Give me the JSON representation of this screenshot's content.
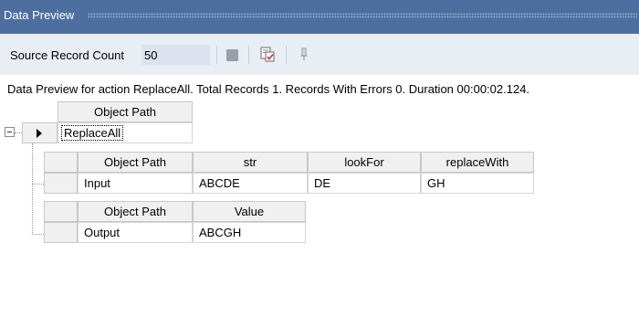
{
  "window": {
    "title": "Data Preview"
  },
  "toolbar": {
    "source_label": "Source Record Count",
    "source_count": "50",
    "icons": [
      "stop-icon",
      "preview-check-icon",
      "pin-icon"
    ]
  },
  "info_line": "Data Preview for action ReplaceAll. Total Records 1. Records With Errors 0. Duration 00:00:02.124.",
  "top_grid": {
    "header": "Object Path",
    "row_value": "ReplaceAll",
    "expand_glyph": "⊟",
    "row_pointer": "▶"
  },
  "input_grid": {
    "headers": [
      "Object Path",
      "str",
      "lookFor",
      "replaceWith"
    ],
    "row": [
      "Input",
      "ABCDE",
      "DE",
      "GH"
    ]
  },
  "output_grid": {
    "headers": [
      "Object Path",
      "Value"
    ],
    "row": [
      "Output",
      "ABCGH"
    ]
  },
  "colors": {
    "titlebar": "#4d6f9f",
    "toolbar": "#e9edf4",
    "count_field": "#dce3ee"
  }
}
